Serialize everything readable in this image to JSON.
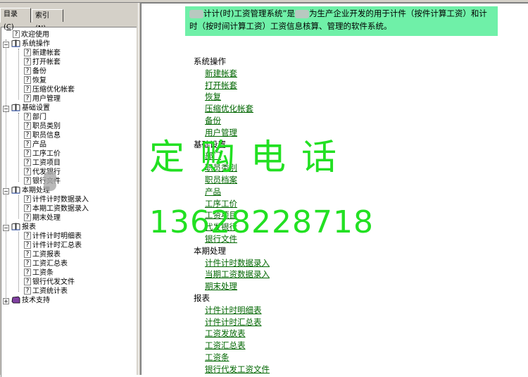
{
  "tabs": [
    {
      "label": "目录",
      "hotkey": "C",
      "active": true
    },
    {
      "label": "索引",
      "hotkey": "N",
      "active": false
    }
  ],
  "tree": {
    "welcome": "欢迎使用",
    "groups": [
      {
        "label": "系统操作",
        "items": [
          "新建帐套",
          "打开帐套",
          "备份",
          "恢复",
          "压缩优化帐套",
          "用户管理"
        ]
      },
      {
        "label": "基础设置",
        "items": [
          "部门",
          "职员类别",
          "职员信息",
          "产品",
          "工序工价",
          "工资项目",
          "代发银行",
          "银行文件"
        ]
      },
      {
        "label": "本期处理",
        "items": [
          "计件计时数据录入",
          "本期工资数据录入",
          "期末处理"
        ]
      },
      {
        "label": "报表",
        "items": [
          "计件计时明细表",
          "计件计时汇总表",
          "工资报表",
          "工资汇总表",
          "工资条",
          "银行代发文件",
          "工资统计表"
        ]
      },
      {
        "label": "技术支持",
        "items": []
      }
    ]
  },
  "content": {
    "intro_part1": "计计(时)工资管理系统”是",
    "intro_part2": "为生产企业开发的用于计件（按件计算工资）和计时（按时间计算工资）工资信息核算、管理的软件系统。",
    "sections": [
      {
        "title": "系统操作",
        "links": [
          "新建帐套",
          "打开帐套",
          "恢复",
          "压缩优化帐套",
          "备份",
          "用户管理"
        ]
      },
      {
        "title": "基础设置",
        "links": [
          "部门",
          "职员类别",
          "职员档案",
          "产品",
          "工序工价",
          "工资项目",
          "代发银行",
          "银行文件"
        ]
      },
      {
        "title": "本期处理",
        "links": [
          "计件计时数据录入",
          "当期工资数据录入",
          "期末处理"
        ]
      },
      {
        "title": "报表",
        "links": [
          "计件计时明细表",
          "计件计时汇总表",
          "工资发放表",
          "工资汇总表",
          "工资条",
          "银行代发工资文件"
        ]
      }
    ]
  },
  "watermark": {
    "line1": "定购电话",
    "line2": "13628228718"
  },
  "colors": {
    "link": "#006600",
    "intro_bg": "#6ff0a8",
    "watermark": "#22e022",
    "chrome": "#d4d0c8"
  }
}
